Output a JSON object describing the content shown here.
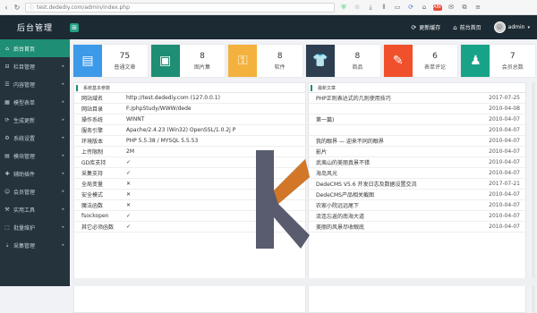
{
  "browser": {
    "url": "test.dedediy.com/admin/index.php",
    "toolbar_icons": [
      "download-icon",
      "library-icon",
      "reader-icon",
      "sync-icon",
      "shield-icon",
      "extension-icon",
      "tab-icon",
      "mail-icon",
      "home-icon",
      "menu-icon"
    ]
  },
  "header": {
    "title": "后台管理",
    "update_cache": "更新缓存",
    "front_home": "前台首页",
    "user": "admin"
  },
  "sidebar": {
    "items": [
      {
        "label": "后台首页",
        "icon": "home-icon",
        "active": true
      },
      {
        "label": "栏目管理",
        "icon": "column-icon",
        "active": false
      },
      {
        "label": "内容管理",
        "icon": "content-icon",
        "active": false
      },
      {
        "label": "模型表单",
        "icon": "model-icon",
        "active": false
      },
      {
        "label": "生成更新",
        "icon": "generate-icon",
        "active": false
      },
      {
        "label": "系统设置",
        "icon": "settings-icon",
        "active": false
      },
      {
        "label": "模块管理",
        "icon": "module-icon",
        "active": false
      },
      {
        "label": "辅助插件",
        "icon": "plugin-icon",
        "active": false
      },
      {
        "label": "会员管理",
        "icon": "member-icon",
        "active": false
      },
      {
        "label": "实用工具",
        "icon": "tools-icon",
        "active": false
      },
      {
        "label": "批量维护",
        "icon": "batch-icon",
        "active": false
      },
      {
        "label": "采集管理",
        "icon": "collect-icon",
        "active": false
      }
    ]
  },
  "cards": [
    {
      "num": "75",
      "label": "普通文章",
      "color": "#3d9ae8",
      "icon": "document-icon"
    },
    {
      "num": "8",
      "label": "图片集",
      "color": "#1e8e74",
      "icon": "image-icon"
    },
    {
      "num": "8",
      "label": "软件",
      "color": "#f3b23e",
      "icon": "software-icon"
    },
    {
      "num": "8",
      "label": "商品",
      "color": "#2c3e50",
      "icon": "shirt-icon"
    },
    {
      "num": "6",
      "label": "表单评论",
      "color": "#f0512c",
      "icon": "comment-icon"
    },
    {
      "num": "7",
      "label": "会员总数",
      "color": "#18a389",
      "icon": "member-icon"
    }
  ],
  "sys_panel": {
    "title": "系统基本参数",
    "rows": [
      {
        "k": "网站域名",
        "v": "http://test.dedediy.com (127.0.0.1)"
      },
      {
        "k": "网站目录",
        "v": "F:/phpStudy/WWW/dede"
      },
      {
        "k": "操作系统",
        "v": "WINNT"
      },
      {
        "k": "服务引擎",
        "v": "Apache/2.4.23 (Win32) OpenSSL/1.0.2j P"
      },
      {
        "k": "环境版本",
        "v": "PHP 5.5.38 / MYSQL 5.5.53"
      },
      {
        "k": "上传限制",
        "v": "2M"
      },
      {
        "k": "GD库支持",
        "v": "✓"
      },
      {
        "k": "采集支持",
        "v": "✓"
      },
      {
        "k": "全局变量",
        "v": "✕"
      },
      {
        "k": "安全模式",
        "v": "✕"
      },
      {
        "k": "魔法函数",
        "v": "✕"
      },
      {
        "k": "fsockopen",
        "v": "✓"
      },
      {
        "k": "其它必须函数",
        "v": "✓"
      }
    ]
  },
  "article_panel": {
    "title": "最新文章",
    "rows": [
      {
        "t": "PHP正则表达式的几则使用技巧",
        "d": "2017-07-25"
      },
      {
        "t": "",
        "d": "2010-04-08"
      },
      {
        "t": "第一篇)",
        "d": "2010-04-07"
      },
      {
        "t": "",
        "d": "2010-04-07"
      },
      {
        "t": "我的眼界 — 迎来不同的眼界",
        "d": "2010-04-07"
      },
      {
        "t": "影片",
        "d": "2010-04-07"
      },
      {
        "t": "武夷山的美丽真景不错",
        "d": "2010-04-07"
      },
      {
        "t": "海岛风光",
        "d": "2010-04-07"
      },
      {
        "t": "DedeCMS V5.6 开发日志及数据设置交流",
        "d": "2017-07-21"
      },
      {
        "t": "DedeCMS产品相关截图",
        "d": "2010-04-07"
      },
      {
        "t": "农家小院远远尾下",
        "d": "2010-04-07"
      },
      {
        "t": "流连忘返的南海大道",
        "d": "2010-04-07"
      },
      {
        "t": "美丽的风景尽收眼底",
        "d": "2010-04-07"
      }
    ]
  }
}
